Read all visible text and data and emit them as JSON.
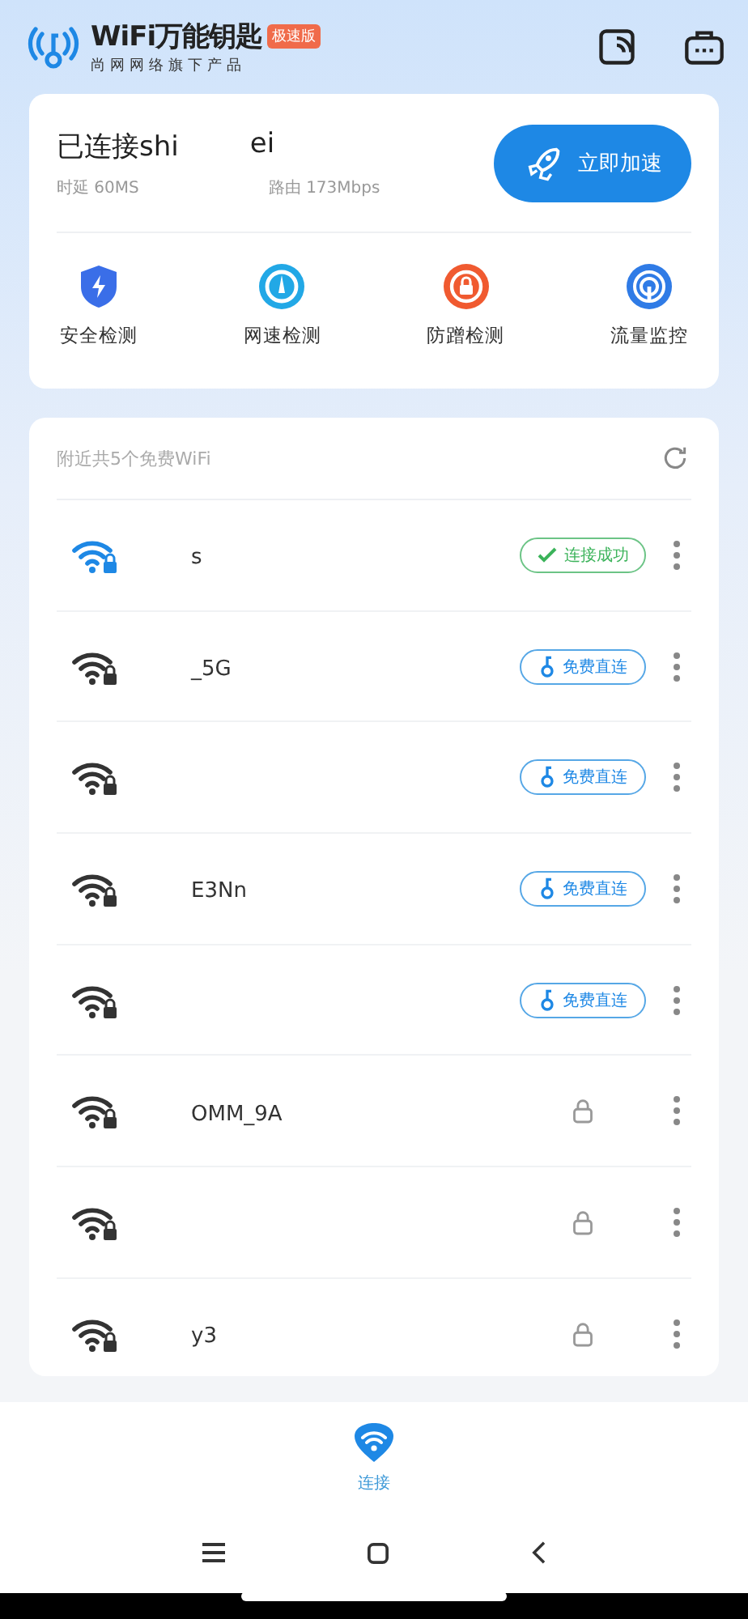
{
  "app": {
    "title": "WiFi万能钥匙",
    "badge": "极速版",
    "subtitle": "尚网网络旗下产品"
  },
  "connection": {
    "name_start": "已连接shi",
    "name_end": "ei",
    "latency": "时延 60MS",
    "router": "路由 173Mbps",
    "boost_button": "立即加速"
  },
  "tools": [
    {
      "label": "安全检测",
      "kind": "shield"
    },
    {
      "label": "网速检测",
      "kind": "speed"
    },
    {
      "label": "防蹭检测",
      "kind": "guard"
    },
    {
      "label": "流量监控",
      "kind": "traffic"
    }
  ],
  "nearby": {
    "title": "附近共5个免费WiFi",
    "networks": [
      {
        "name": "s",
        "kind": "connected",
        "action": "连接成功"
      },
      {
        "name": "_5G",
        "kind": "free",
        "action": "免费直连"
      },
      {
        "kind": "free",
        "action": "免费直连"
      },
      {
        "name": "E3Nn",
        "kind": "free",
        "action": "免费直连"
      },
      {
        "kind": "free",
        "action": "免费直连"
      },
      {
        "name": "OMM_9A",
        "kind": "locked"
      },
      {
        "kind": "locked"
      },
      {
        "name": "y3",
        "kind": "locked"
      }
    ]
  },
  "bottom_nav": [
    {
      "label": "连接",
      "selected": true
    }
  ]
}
